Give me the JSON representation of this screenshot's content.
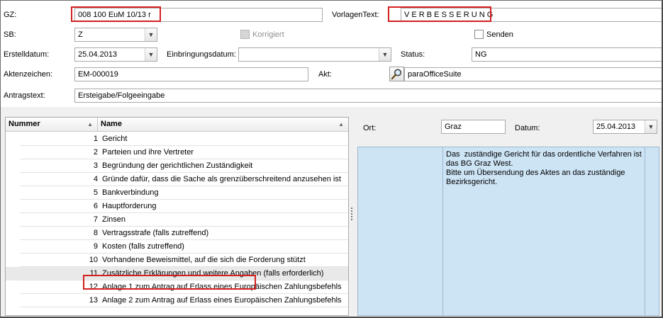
{
  "form": {
    "gz_label": "GZ:",
    "gz_value": "008 100 EuM 10/13 r",
    "vorlagentext_label": "VorlagenText:",
    "vorlagentext_value": "V E R B E S S E R U N G",
    "sb_label": "SB:",
    "sb_value": "Z",
    "korrigiert_label": "Korrigiert",
    "senden_label": "Senden",
    "erstelldatum_label": "Erstelldatum:",
    "erstelldatum_value": "25.04.2013",
    "einbringungsdatum_label": "Einbringungsdatum:",
    "einbringungsdatum_value": "",
    "status_label": "Status:",
    "status_value": "NG",
    "aktenzeichen_label": "Aktenzeichen:",
    "aktenzeichen_value": "EM-000019",
    "akt_label": "Akt:",
    "akt_value": "paraOfficeSuite",
    "antragstext_label": "Antragstext:",
    "antragstext_value": "Ersteigabe/Folgeeingabe"
  },
  "list": {
    "col_nummer": "Nummer",
    "col_name": "Name",
    "rows": [
      {
        "num": "1",
        "name": "Gericht"
      },
      {
        "num": "2",
        "name": "Parteien und ihre Vertreter"
      },
      {
        "num": "3",
        "name": "Begründung der gerichtlichen Zuständigkeit"
      },
      {
        "num": "4",
        "name": "Gründe dafür, dass die Sache als grenzüberschreitend anzusehen ist"
      },
      {
        "num": "5",
        "name": "Bankverbindung"
      },
      {
        "num": "6",
        "name": "Hauptforderung"
      },
      {
        "num": "7",
        "name": "Zinsen"
      },
      {
        "num": "8",
        "name": "Vertragsstrafe (falls zutreffend)"
      },
      {
        "num": "9",
        "name": "Kosten (falls zutreffend)"
      },
      {
        "num": "10",
        "name": "Vorhandene Beweismittel, auf die sich die Forderung stützt"
      },
      {
        "num": "11",
        "name": "Zusätzliche Erklärungen und weitere Angaben (falls erforderlich)"
      },
      {
        "num": "12",
        "name": "Anlage 1 zum Antrag auf Erlass eines Europäischen Zahlungsbefehls"
      },
      {
        "num": "13",
        "name": "Anlage 2 zum Antrag auf Erlass eines Europäischen Zahlungsbefehls"
      }
    ]
  },
  "detail": {
    "ort_label": "Ort:",
    "ort_value": "Graz",
    "datum_label": "Datum:",
    "datum_value": "25.04.2013",
    "note": "Das  zuständige Gericht für das ordentliche Verfahren ist\ndas BG Graz West.\nBitte um Übersendung des Aktes an das zuständige\nBezirksgericht."
  },
  "colors": {
    "highlight": "#d42020",
    "note_background": "#cde4f5"
  },
  "icons": [
    "chevron-down-icon",
    "search-icon",
    "sort-up-icon",
    "splitter-grip-icon"
  ]
}
